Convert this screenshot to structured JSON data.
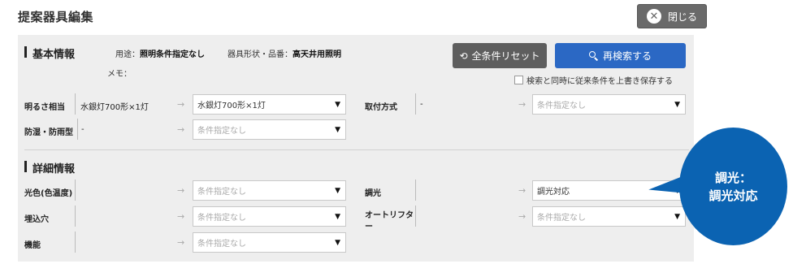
{
  "page": {
    "title": "提案器具編集"
  },
  "close_button": {
    "label": "閉じる",
    "icon": "close-icon"
  },
  "basic": {
    "title": "基本情報",
    "usage_label": "用途：",
    "usage_value": "照明条件指定なし",
    "fixture_label": "器具形状・品番：",
    "fixture_value": "高天井用照明",
    "memo_label": "メモ："
  },
  "buttons": {
    "reset_label": "全条件リセット",
    "search_label": "再検索する"
  },
  "save_checkbox": {
    "label": "検索と同時に従来条件を上書き保存する",
    "checked": false
  },
  "rows": {
    "brightness": {
      "label": "明るさ相当",
      "current": "水銀灯700形×1灯",
      "select": "水銀灯700形×1灯"
    },
    "mounting": {
      "label": "取付方式",
      "current": "-",
      "select": "条件指定なし"
    },
    "waterproof": {
      "label": "防湿・防雨型",
      "current": "-",
      "select": "条件指定なし"
    }
  },
  "detail": {
    "title": "詳細情報",
    "light_color": {
      "label": "光色(色温度)",
      "select": "条件指定なし"
    },
    "dimming": {
      "label": "調光",
      "select": "調光対応"
    },
    "embed_hole": {
      "label": "埋込穴",
      "select": "条件指定なし"
    },
    "auto_lifter": {
      "label": "オートリフター",
      "select": "条件指定なし"
    },
    "function": {
      "label": "機能",
      "select": "条件指定なし"
    }
  },
  "arrow_glyph": "→",
  "callout": {
    "line1": "調光：",
    "line2": "調光対応",
    "color": "#0b63b2"
  },
  "colors": {
    "search_button": "#2b68c4",
    "reset_button": "#5e5e5e",
    "panel_bg": "#eeeeee"
  }
}
